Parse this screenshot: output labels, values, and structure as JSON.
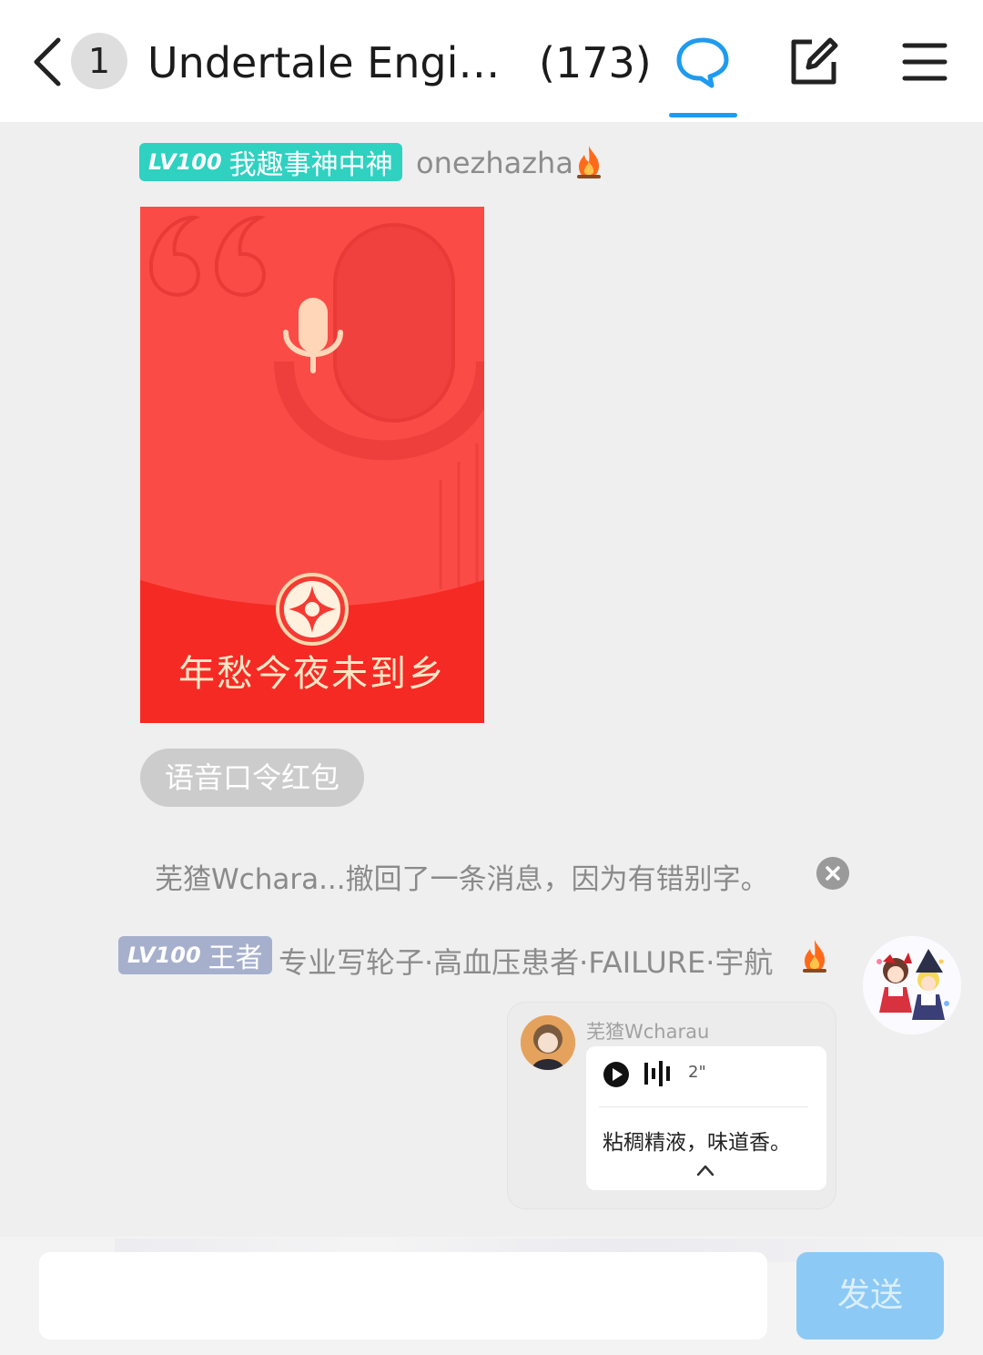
{
  "header": {
    "unread_count": "1",
    "title": "Undertale Engine…",
    "member_count": "(173)",
    "accent_color": "#1e9bf0",
    "icons": [
      "back-icon",
      "chat-bubble-icon",
      "edit-icon",
      "menu-icon"
    ]
  },
  "messages": [
    {
      "level": "LV100",
      "title": "我趣事神中神",
      "name": "onezhazha",
      "badge_color": "#2fd1c0",
      "red_packet": {
        "text": "年愁今夜未到乡",
        "label": "语音口令红包"
      }
    }
  ],
  "recall_notice": "芜猹Wchara...撤回了一条消息，因为有错别字。",
  "message2": {
    "level": "LV100",
    "title": "王者",
    "name": "专业写轮子·高血压患者·FAILURE·宇航",
    "badge_color": "#a6b0cd",
    "quote": {
      "name": "芜猹Wcharau",
      "duration": "2\"",
      "text": "粘稠精液，味道香。"
    }
  },
  "composer": {
    "send_label": "发送",
    "send_color": "#8ccaf5"
  }
}
